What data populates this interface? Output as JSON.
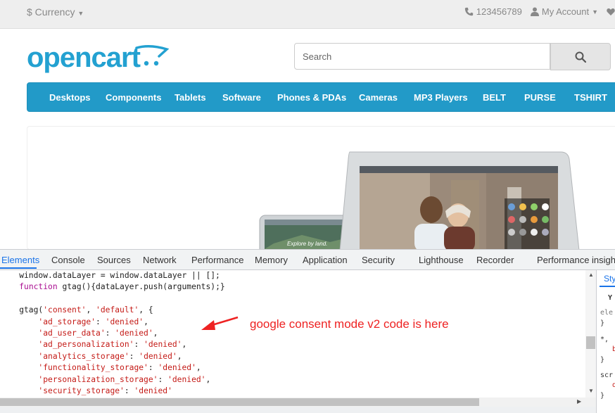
{
  "topbar": {
    "currency": "$ Currency",
    "phone": "123456789",
    "account": "My Account"
  },
  "header": {
    "logo_text": "opencart",
    "search_placeholder": "Search"
  },
  "menu": {
    "items": [
      "Desktops",
      "Components",
      "Tablets",
      "Software",
      "Phones & PDAs",
      "Cameras",
      "MP3 Players",
      "BELT",
      "PURSE",
      "TSHIRT"
    ]
  },
  "banner": {
    "small_screen_caption": "Explore by land."
  },
  "devtools": {
    "tabs": [
      "Elements",
      "Console",
      "Sources",
      "Network",
      "Performance",
      "Memory",
      "Application",
      "Security",
      "Lighthouse",
      "Recorder",
      "Performance insights"
    ],
    "active_tab": "Elements",
    "code_lines": [
      "    window.dataLayer = window.dataLayer || [];",
      "    function gtag(){dataLayer.push(arguments);}",
      "",
      "    gtag('consent', 'default', {",
      "        'ad_storage': 'denied',",
      "        'ad_user_data': 'denied',",
      "        'ad_personalization': 'denied',",
      "        'analytics_storage': 'denied',",
      "        'functionality_storage': 'denied',",
      "        'personalization_storage': 'denied',",
      "        'security_storage': 'denied'"
    ],
    "styles_tab": "Sty",
    "side_lines": [
      "Y",
      "ele",
      "}",
      "*,",
      "b",
      "}",
      "scr",
      "d",
      "}"
    ]
  },
  "annotation": {
    "text": "google consent mode v2 code is here",
    "color": "#ee2222"
  },
  "colors": {
    "brand": "#23a1d1",
    "menu_bg": "#229ac8",
    "devtools_active": "#1a73e8"
  }
}
